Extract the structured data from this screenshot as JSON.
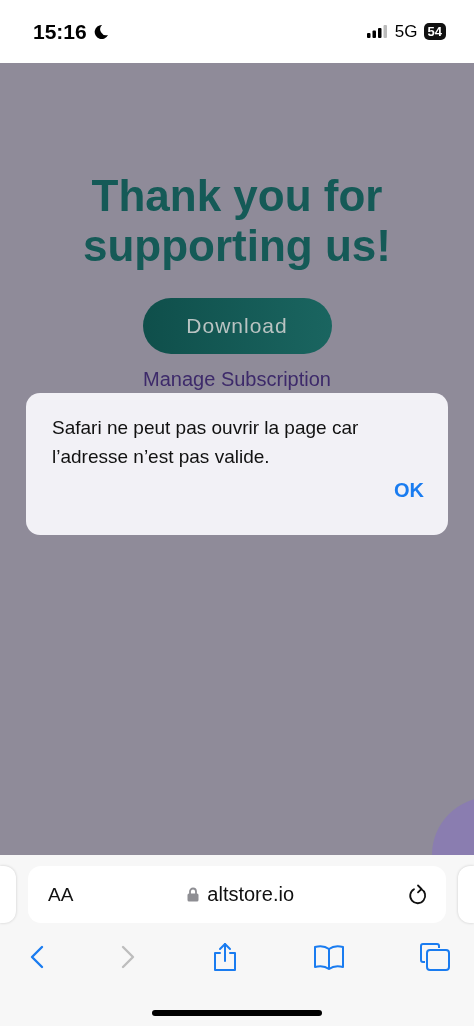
{
  "status_bar": {
    "time": "15:16",
    "network": "5G",
    "battery": "54"
  },
  "page": {
    "title": "Thank you for supporting us!",
    "button": "Download",
    "link": "Manage Subscription"
  },
  "alert": {
    "message": "Safari ne peut pas ouvrir la page car l’adresse n’est pas valide.",
    "button": "OK"
  },
  "address_bar": {
    "text_size": "AA",
    "url": "altstore.io"
  },
  "toolbar": [
    {
      "kind": "back",
      "disabled": false
    },
    {
      "kind": "forward",
      "disabled": true
    },
    {
      "kind": "share",
      "disabled": false
    },
    {
      "kind": "bookmarks",
      "disabled": false
    },
    {
      "kind": "tabs",
      "disabled": false
    }
  ]
}
